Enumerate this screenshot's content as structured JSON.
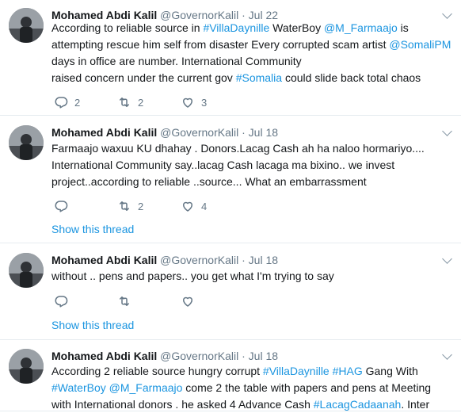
{
  "tweets": [
    {
      "name": "Mohamed Abdi Kalil",
      "handle": "@GovernorKalil",
      "separator": "·",
      "time": "Jul 22",
      "lines": [
        [
          {
            "t": "According to reliable source in "
          },
          {
            "t": "#VillaDaynille",
            "link": true
          },
          {
            "t": " WaterBoy "
          },
          {
            "t": "@M_Farmaajo",
            "link": true
          },
          {
            "t": " is"
          }
        ],
        [
          {
            "t": "attempting rescue him self from disaster Every corrupted scam artist "
          },
          {
            "t": "@SomaliPM",
            "link": true
          }
        ],
        [
          {
            "t": "days in office are number. International Community"
          }
        ],
        [
          {
            "t": "raised concern under the current gov "
          },
          {
            "t": "#Somalia",
            "link": true
          },
          {
            "t": " could slide back  total chaos"
          }
        ]
      ],
      "replies": "2",
      "retweets": "2",
      "likes": "3",
      "show_thread": ""
    },
    {
      "name": "Mohamed Abdi Kalil",
      "handle": "@GovernorKalil",
      "separator": "·",
      "time": "Jul 18",
      "lines": [
        [
          {
            "t": "Farmaajo waxuu KU dhahay . Donors.Lacag Cash ah ha naloo hormariyo...."
          }
        ],
        [
          {
            "t": "International Community say..lacag Cash lacaga ma bixino..  we invest"
          }
        ],
        [
          {
            "t": "project..according to reliable ..source... What an embarrassment"
          }
        ]
      ],
      "replies": "",
      "retweets": "2",
      "likes": "4",
      "show_thread": "Show this thread"
    },
    {
      "name": "Mohamed Abdi Kalil",
      "handle": "@GovernorKalil",
      "separator": "·",
      "time": "Jul 18",
      "lines": [
        [
          {
            "t": "without .. pens and  papers.. you get what I'm trying to say"
          }
        ]
      ],
      "replies": "",
      "retweets": "",
      "likes": "",
      "show_thread": "Show this thread"
    },
    {
      "name": "Mohamed Abdi Kalil",
      "handle": "@GovernorKalil",
      "separator": "·",
      "time": "Jul 18",
      "lines": [
        [
          {
            "t": "According 2 reliable source hungry  corrupt "
          },
          {
            "t": "#VillaDaynille",
            "link": true
          },
          {
            "t": " "
          },
          {
            "t": "#HAG",
            "link": true
          },
          {
            "t": " Gang With"
          }
        ],
        [
          {
            "t": "#WaterBoy",
            "link": true
          },
          {
            "t": " "
          },
          {
            "t": "@M_Farmaajo",
            "link": true
          },
          {
            "t": "  come 2 the table with papers and pens at Meeting"
          }
        ],
        [
          {
            "t": "with International donors . he asked 4 Advance Cash "
          },
          {
            "t": "#LacagCadaanah",
            "link": true
          },
          {
            "t": ". Inter"
          }
        ]
      ],
      "replies": "",
      "retweets": "",
      "likes": "",
      "show_thread": ""
    }
  ],
  "colors": {
    "link": "#1b95e0",
    "muted": "#657786",
    "divider": "#e6ecf0"
  },
  "icons": {
    "reply": "reply-icon",
    "retweet": "retweet-icon",
    "like": "heart-icon",
    "more": "chevron-down-icon"
  }
}
